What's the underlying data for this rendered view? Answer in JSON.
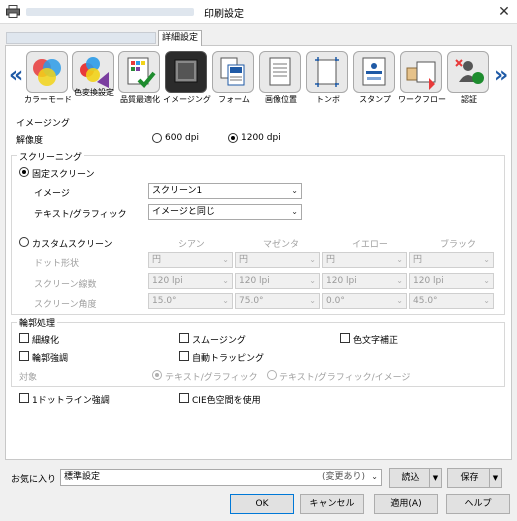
{
  "window": {
    "title": "印刷設定",
    "close_glyph": "✕"
  },
  "tabs": {
    "active_label": "詳細設定"
  },
  "icon_strip": {
    "left_arrow": "«",
    "right_arrow": "»",
    "items": [
      {
        "label": "カラーモード",
        "icon": "color-mode-icon"
      },
      {
        "label": "色変換設定",
        "icon": "color-conversion-icon"
      },
      {
        "label": "品質最適化",
        "icon": "quality-optimize-icon"
      },
      {
        "label": "イメージング",
        "icon": "imaging-icon",
        "selected": true
      },
      {
        "label": "フォーム",
        "icon": "form-icon"
      },
      {
        "label": "画像位置",
        "icon": "image-position-icon"
      },
      {
        "label": "トンボ",
        "icon": "crop-marks-icon"
      },
      {
        "label": "スタンプ",
        "icon": "stamp-icon"
      },
      {
        "label": "ワークフロー",
        "icon": "workflow-icon"
      },
      {
        "label": "認証",
        "icon": "authentication-icon"
      }
    ]
  },
  "imaging": {
    "group_label": "イメージング",
    "resolution_label": "解像度",
    "res_600": "600 dpi",
    "res_1200": "1200 dpi"
  },
  "screening": {
    "group_label": "スクリーニング",
    "fixed_label": "固定スクリーン",
    "image_label": "イメージ",
    "image_value": "スクリーン1",
    "text_graphic_label": "テキスト/グラフィック",
    "text_graphic_value": "イメージと同じ",
    "custom_label": "カスタムスクリーン",
    "columns": [
      "シアン",
      "マゼンタ",
      "イエロー",
      "ブラック"
    ],
    "rows": [
      {
        "label": "ドット形状",
        "values": [
          "円",
          "円",
          "円",
          "円"
        ]
      },
      {
        "label": "スクリーン線数",
        "values": [
          "120 lpi",
          "120 lpi",
          "120 lpi",
          "120 lpi"
        ]
      },
      {
        "label": "スクリーン角度",
        "values": [
          "15.0°",
          "75.0°",
          "0.0°",
          "45.0°"
        ]
      }
    ]
  },
  "edge": {
    "group_label": "輪郭処理",
    "thin_line": "細線化",
    "smoothing": "スムージング",
    "color_text_correction": "色文字補正",
    "edge_enhance": "輪郭強調",
    "auto_trapping": "自動トラッピング",
    "target_label": "対象",
    "target_text_graphic": "テキスト/グラフィック",
    "target_text_graphic_image": "テキスト/グラフィック/イメージ"
  },
  "options": {
    "one_dot_line": "1ドットライン強調",
    "cie_color_space": "CIE色空間を使用"
  },
  "favorites": {
    "label": "お気に入り",
    "value": "標準設定",
    "status": "(変更あり)",
    "load": "読込",
    "save": "保存"
  },
  "footer": {
    "ok": "OK",
    "cancel": "キャンセル",
    "apply": "適用(A)",
    "help": "ヘルプ"
  }
}
